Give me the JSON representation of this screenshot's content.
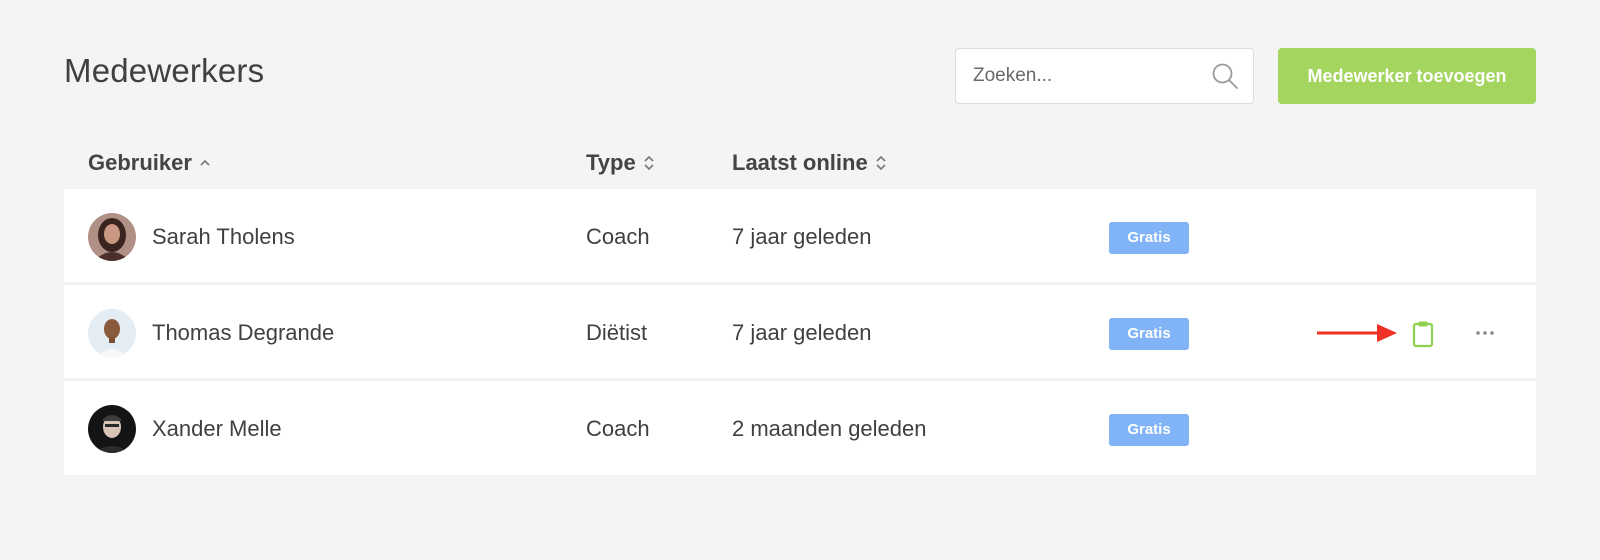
{
  "page": {
    "title": "Medewerkers"
  },
  "search": {
    "placeholder": "Zoeken...",
    "value": "",
    "icon": "search-icon"
  },
  "toolbar": {
    "add_label": "Medewerker toevoegen",
    "add_color": "#a3d55f"
  },
  "columns": [
    {
      "label": "Gebruiker",
      "sort": "ascending"
    },
    {
      "label": "Type",
      "sort": "none"
    },
    {
      "label": "Laatst online",
      "sort": "none"
    }
  ],
  "rows": [
    {
      "name": "Sarah Tholens",
      "type": "Coach",
      "last_online": "7 jaar geleden",
      "badge": "Gratis",
      "avatar": "avatar-woman-dark-hair"
    },
    {
      "name": "Thomas Degrande",
      "type": "Diëtist",
      "last_online": "7 jaar geleden",
      "badge": "Gratis",
      "avatar": "avatar-man-light-background"
    },
    {
      "name": "Xander Melle",
      "type": "Coach",
      "last_online": "2 maanden geleden",
      "badge": "Gratis",
      "avatar": "avatar-man-dark-background"
    }
  ],
  "row_actions": {
    "clipboard_icon": "clipboard-icon",
    "more_icon": "more-horizontal-icon"
  },
  "colors": {
    "badge": "#81b3f7",
    "accent": "#a3d55f",
    "annotation_arrow": "#ee3124"
  }
}
